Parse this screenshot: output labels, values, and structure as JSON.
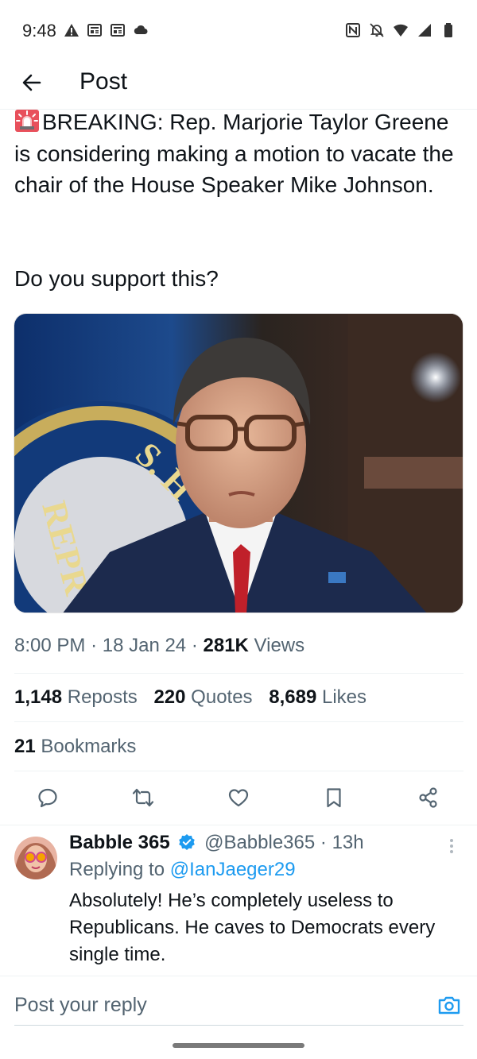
{
  "status_bar": {
    "time": "9:48",
    "left_icons": [
      "alert-triangle-icon",
      "news-icon",
      "news-icon",
      "cloud-icon"
    ],
    "right_icons": [
      "nfc-icon",
      "bell-off-icon",
      "wifi-icon",
      "signal-icon",
      "battery-icon"
    ]
  },
  "header": {
    "title": "Post",
    "back_icon": "arrow-left-icon"
  },
  "post": {
    "emoji": "police-light-emoji",
    "text": "BREAKING: Rep. Marjorie Taylor Greene is considering making a motion to vacate the chair of the House Speaker Mike Johnson.",
    "question": "Do you support this?",
    "time": "8:00 PM",
    "date": "18 Jan 24",
    "views_count": "281K",
    "views_label": "Views",
    "reposts_count": "1,148",
    "reposts_label": "Reposts",
    "quotes_count": "220",
    "quotes_label": "Quotes",
    "likes_count": "8,689",
    "likes_label": "Likes",
    "bookmarks_count": "21",
    "bookmarks_label": "Bookmarks"
  },
  "actions": [
    "reply-icon",
    "repost-icon",
    "like-icon",
    "bookmark-icon",
    "share-icon"
  ],
  "reply": {
    "name": "Babble 365",
    "handle": "@Babble365",
    "separator": "·",
    "age": "13h",
    "replying_prefix": "Replying to",
    "replying_to": "@IanJaeger29",
    "text": "Absolutely! He’s completely useless to Republicans. He caves to Democrats every single time."
  },
  "compose": {
    "placeholder": "Post your reply"
  },
  "colors": {
    "accent": "#1d9bf0",
    "text_primary": "#0f1419",
    "text_secondary": "#536471",
    "divider": "#eff3f4"
  }
}
